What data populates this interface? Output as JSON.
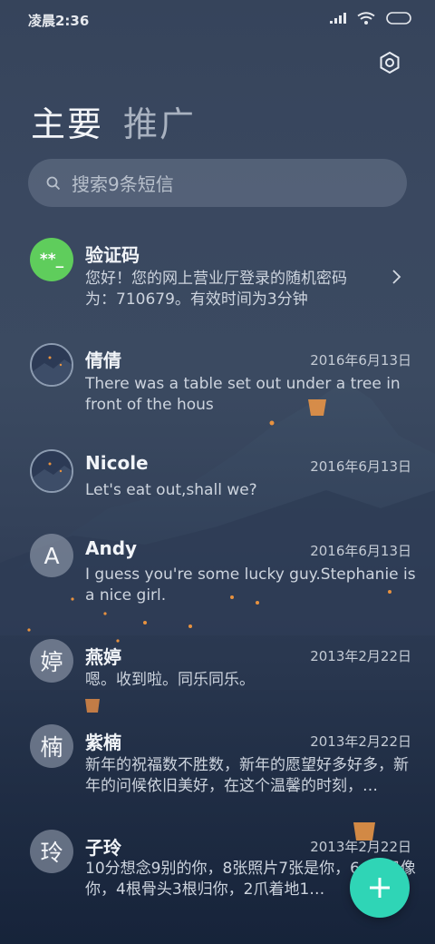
{
  "status_bar": {
    "time": "凌晨2:36"
  },
  "tabs": {
    "primary": "主要",
    "promo": "推广"
  },
  "search": {
    "placeholder": "搜索9条短信"
  },
  "messages": [
    {
      "name": "验证码",
      "avatar_text": "**_",
      "date": "",
      "preview": "您好！您的网上营业厅登录的随机密码为：710679。有效时间为3分钟"
    },
    {
      "name": "倩倩",
      "avatar_text": "",
      "date": "2016年6月13日",
      "preview": "There was a table set out under a tree in front of the hous"
    },
    {
      "name": "Nicole",
      "avatar_text": "",
      "date": "2016年6月13日",
      "preview": "Let's eat out,shall we?"
    },
    {
      "name": "Andy",
      "avatar_text": "A",
      "date": "2016年6月13日",
      "preview": "I guess you're some lucky guy.Stephanie is a nice girl."
    },
    {
      "name": "燕婷",
      "avatar_text": "婷",
      "date": "2013年2月22日",
      "preview": "嗯。收到啦。同乐同乐。"
    },
    {
      "name": "紫楠",
      "avatar_text": "楠",
      "date": "2013年2月22日",
      "preview": "新年的祝福数不胜数，新年的愿望好多好多，新年的问候依旧美好，在这个温馨的时刻，…"
    },
    {
      "name": "子玲",
      "avatar_text": "玲",
      "date": "2013年2月22日",
      "preview": "10分想念9别的你，8张照片7张是你，6…5只像你，4根骨头3根归你，2爪着地1…"
    }
  ],
  "colors": {
    "fab": "#2fd5b6",
    "code_avatar": "#5fcd5c"
  }
}
